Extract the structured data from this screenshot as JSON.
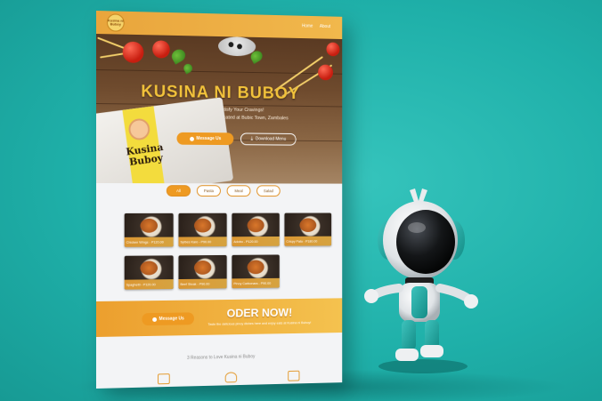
{
  "topbar": {
    "logo_text": "Kusina ni Buboy",
    "nav": [
      "Home",
      "About"
    ]
  },
  "hero": {
    "title": "KUSINA NI BUBOY",
    "subtitle_line1": "Satisfy Your Cravings!",
    "subtitle_line2": "Located at Bubic Town, Zambales",
    "box_brand": "Kusina Buboy",
    "message_button": "Message Us",
    "download_button": "Download Menu"
  },
  "filters": [
    {
      "label": "All",
      "active": true
    },
    {
      "label": "Pasta",
      "active": false
    },
    {
      "label": "Meal",
      "active": false
    },
    {
      "label": "Salad",
      "active": false
    }
  ],
  "menu_items": [
    "Chicken Wings - P120.00",
    "Sylbes Kare - P90.00",
    "Adobo - P120.00",
    "Crispy Pata - P180.00",
    "Spaghetti - P120.00",
    "Beef Steak - P90.00",
    "Pinoy Carbonara - P90.00"
  ],
  "order": {
    "button": "Message Us",
    "title": "ODER NOW!",
    "subtitle": "Taste the delicious pinoy dishes here and enjoy eats at Kusina ni Buboy!"
  },
  "reasons_heading": "3 Reasons to Love Kusina ni Buboy",
  "colors": {
    "accent": "#ee9a22",
    "accent_light": "#f4c24f",
    "background": "#1fb0a9"
  },
  "icons": [
    "message-icon",
    "download-icon",
    "robot-mascot",
    "feature-menu-icon",
    "feature-heart-icon",
    "feature-badge-icon"
  ]
}
